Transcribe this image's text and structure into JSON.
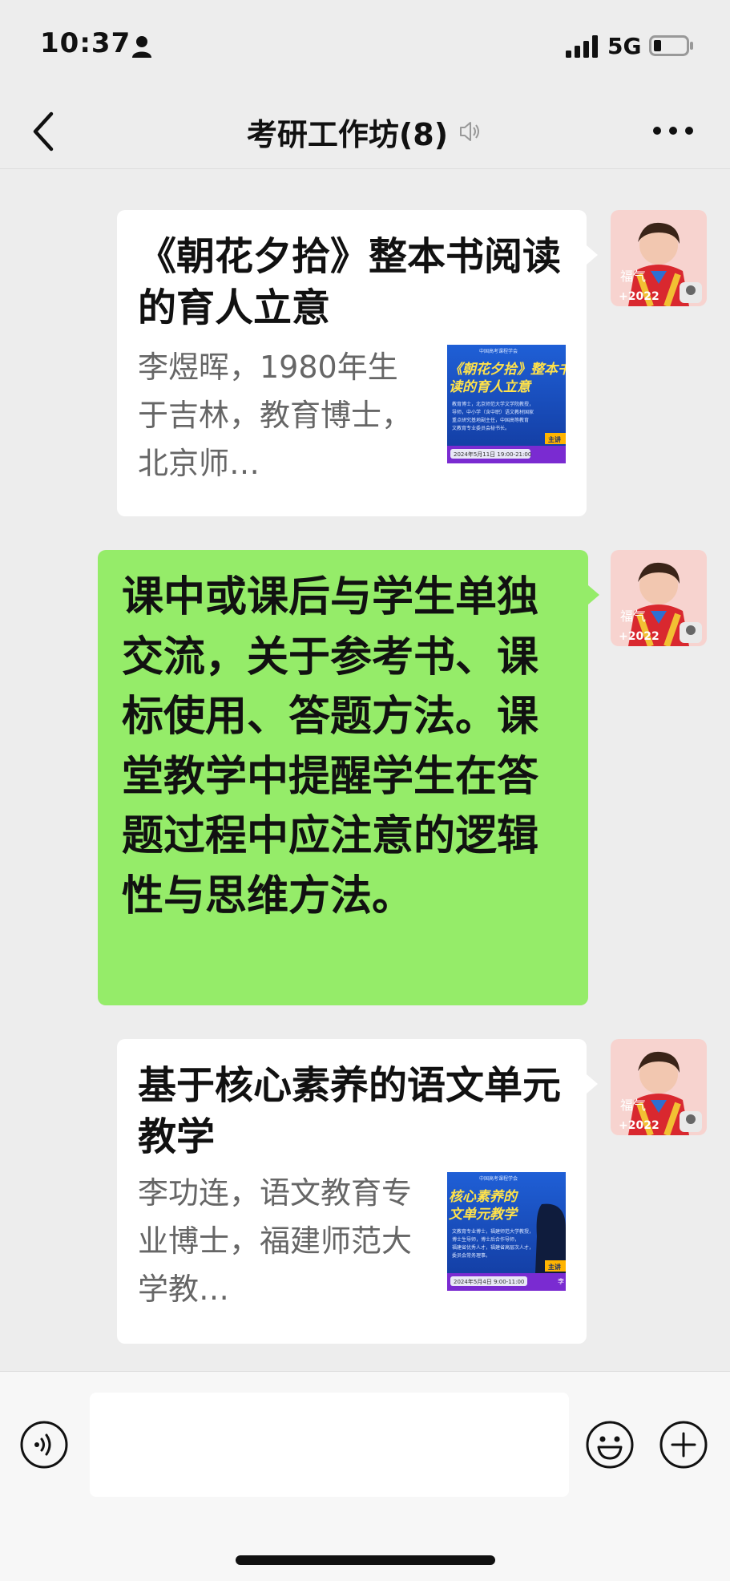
{
  "status": {
    "time": "10:37",
    "network": "5G"
  },
  "nav": {
    "title": "考研工作坊(8)"
  },
  "messages": [
    {
      "type": "card",
      "title": "《朝花夕拾》整本书阅读的育人立意",
      "desc": "李煜晖，1980年生于吉林，教育博士，北京师…",
      "thumb": {
        "heading_lines": [
          "《朝花夕拾》整本书",
          "读的育人立意"
        ],
        "small_lines": [
          "中国高考课程学会",
          "教育博士，北京师范大学文学院教授，",
          "导师，中小学（含中职）语文教材国家",
          "重点研究基地副主任，中国高等教育",
          "文教育专业委员会秘书长。"
        ],
        "speaker_tag": "主讲",
        "date": "2024年5月11日  19:00-21:00"
      }
    },
    {
      "type": "text",
      "text": "课中或课后与学生单独交流，关于参考书、课标使用、答题方法。课堂教学中提醒学生在答题过程中应注意的逻辑性与思维方法。"
    },
    {
      "type": "card",
      "title": "基于核心素养的语文单元教学",
      "desc": "李功连，语文教育专业博士，福建师范大学教…",
      "thumb": {
        "heading_lines": [
          "核心素养的",
          "文单元教学"
        ],
        "small_lines": [
          "中国高考课程学会",
          "文教育专业博士，福建师范大学教授，",
          "博士生导师，博士后合作导师，",
          "福建省优秀人才，福建省高层次人才，",
          "委员会常务理事。"
        ],
        "speaker_tag": "主讲",
        "speaker_initial": "李",
        "date": "2024年5月4日  9:00-11:00"
      }
    }
  ],
  "avatar": {
    "caption": "+2022",
    "badge": "福气"
  },
  "input": {
    "placeholder": ""
  },
  "colors": {
    "green_bubble": "#95ec69",
    "background": "#ededed",
    "thumb_blue": "#1a47b8"
  }
}
